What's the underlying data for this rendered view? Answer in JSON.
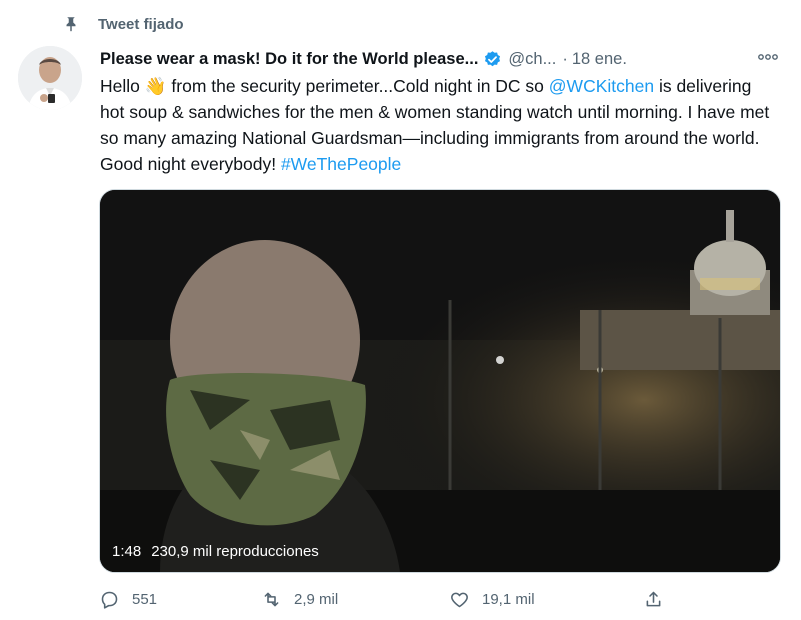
{
  "pinned": {
    "label": "Tweet fijado",
    "icon": "pin-icon"
  },
  "tweet": {
    "display_name": "Please wear a mask! Do it for the World please...",
    "handle": "@ch...",
    "separator": "·",
    "date": "18 ene.",
    "text_parts": {
      "t1": "Hello ",
      "emoji": "👋",
      "t2": " from the security perimeter...Cold night in DC so ",
      "mention": "@WCKitchen",
      "t3": " is delivering hot soup & sandwiches for the men & women standing watch until morning. I have met so many amazing National Guardsman—including immigrants from around the world. Good night everybody! ",
      "hashtag": "#WeThePeople"
    }
  },
  "video": {
    "duration": "1:48",
    "views": "230,9 mil reproducciones"
  },
  "actions": {
    "replies": "551",
    "retweets": "2,9 mil",
    "likes": "19,1 mil"
  },
  "colors": {
    "accent": "#1d9bf0",
    "secondary_text": "#536471",
    "text": "#0f1419"
  }
}
